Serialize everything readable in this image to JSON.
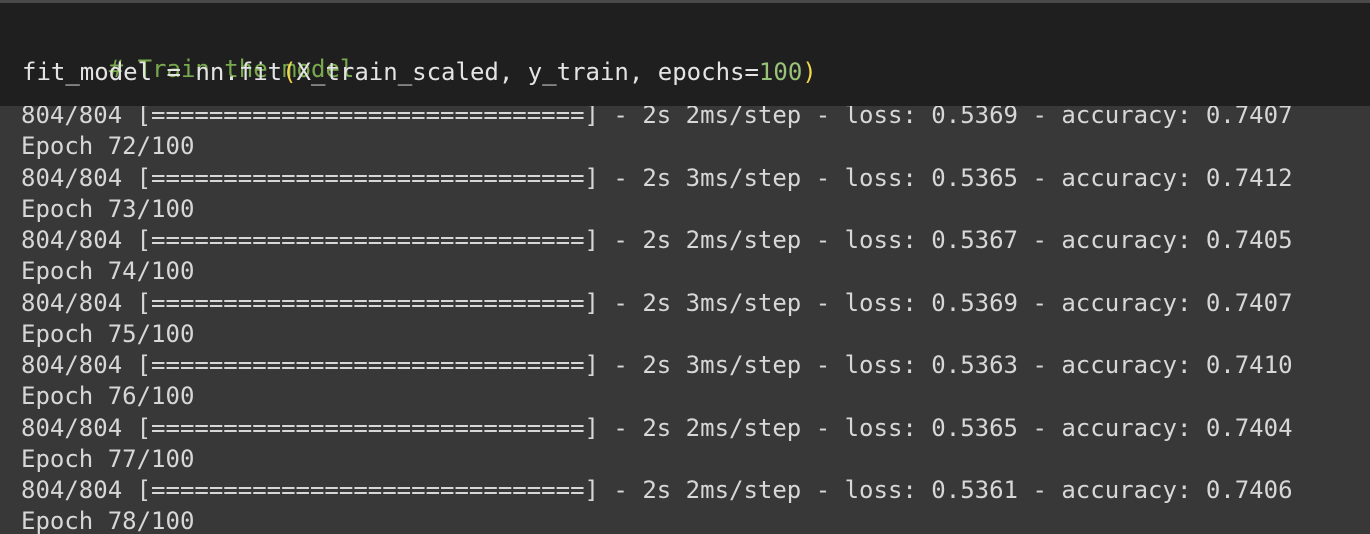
{
  "code_cell": {
    "comment": "# Train the model",
    "line2_assign": "fit_model = nn.fit",
    "line2_open_paren": "(",
    "line2_args": "X_train_scaled, y_train, epochs=",
    "line2_number": "100",
    "line2_close_paren": ")"
  },
  "colors": {
    "code_background": "#1f1f1f",
    "output_background": "#383838",
    "comment": "#79a94e",
    "paren": "#f2d64b",
    "text": "#d7d7d7"
  },
  "output_lines": [
    "804/804 [==============================] - 2s 2ms/step - loss: 0.5369 - accuracy: 0.7407",
    "Epoch 72/100",
    "804/804 [==============================] - 2s 3ms/step - loss: 0.5365 - accuracy: 0.7412",
    "Epoch 73/100",
    "804/804 [==============================] - 2s 2ms/step - loss: 0.5367 - accuracy: 0.7405",
    "Epoch 74/100",
    "804/804 [==============================] - 2s 3ms/step - loss: 0.5369 - accuracy: 0.7407",
    "Epoch 75/100",
    "804/804 [==============================] - 2s 3ms/step - loss: 0.5363 - accuracy: 0.7410",
    "Epoch 76/100",
    "804/804 [==============================] - 2s 2ms/step - loss: 0.5365 - accuracy: 0.7404",
    "Epoch 77/100",
    "804/804 [==============================] - 2s 2ms/step - loss: 0.5361 - accuracy: 0.7406",
    "Epoch 78/100"
  ]
}
